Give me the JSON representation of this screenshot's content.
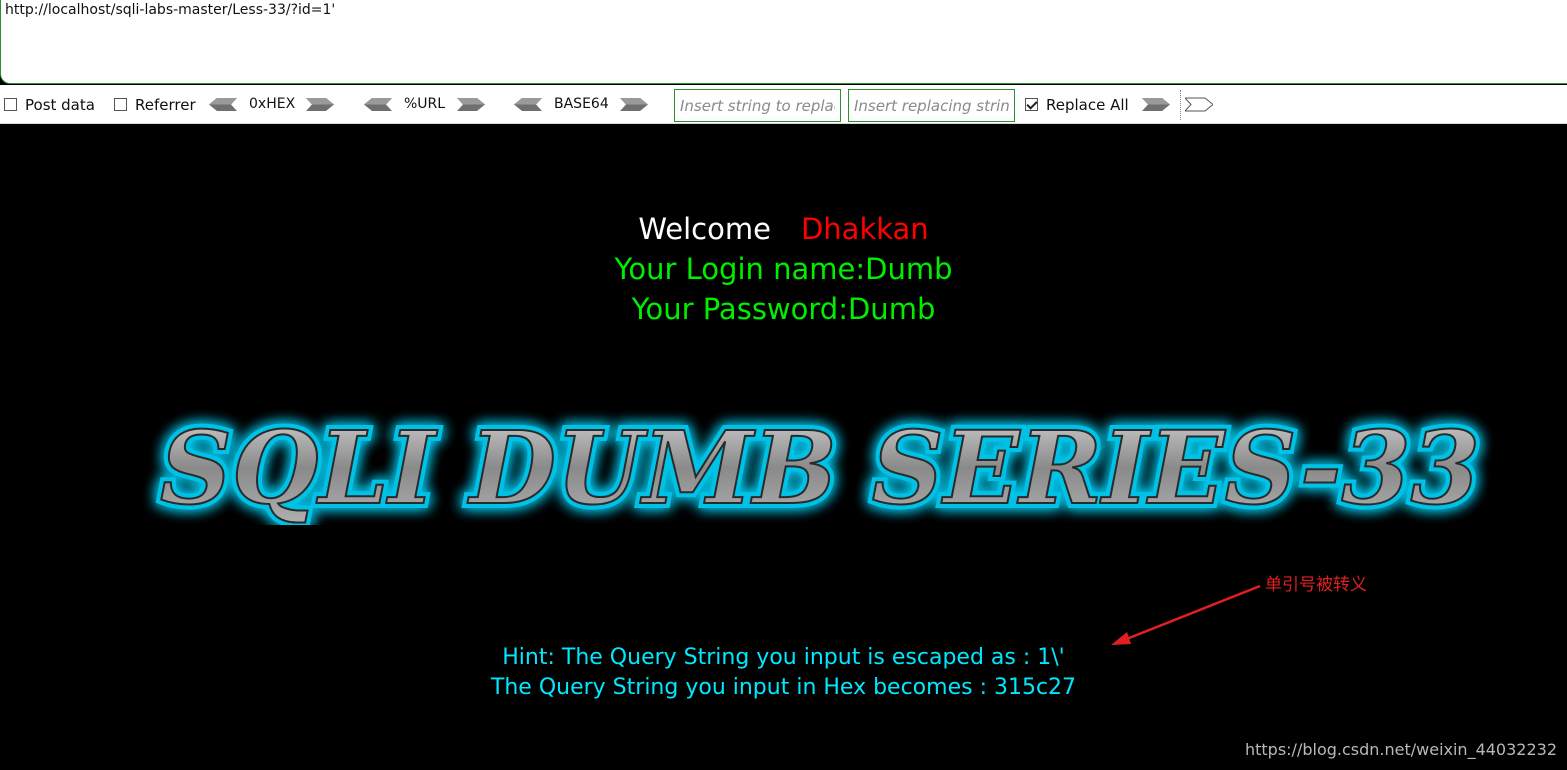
{
  "url_bar": {
    "value": "http://localhost/sqli-labs-master/Less-33/?id=1'"
  },
  "toolbar": {
    "post_data_label": "Post data",
    "referrer_label": "Referrer",
    "hex_label": "0xHEX",
    "url_label": "%URL",
    "base64_label": "BASE64",
    "replace_placeholder": "Insert string to replace",
    "replacing_placeholder": "Insert replacing string",
    "replace_all_label": "Replace All",
    "post_data_checked": false,
    "referrer_checked": false,
    "replace_all_checked": true
  },
  "page": {
    "welcome": "Welcome",
    "user": "Dhakkan",
    "login_name": "Your Login name:Dumb",
    "password": "Your Password:Dumb",
    "banner": "SQLI DUMB SERIES-33",
    "hint_escaped": "Hint: The Query String you input is escaped as : 1\\'",
    "hint_hex": "The Query String you input in Hex becomes : 315c27"
  },
  "annotation": {
    "text": "单引号被转义"
  },
  "watermark": "https://blog.csdn.net/weixin_44032232",
  "colors": {
    "background": "#000000",
    "welcome": "#ffffff",
    "user": "#ff0000",
    "credentials": "#00ee00",
    "hint": "#00e8ff",
    "banner_glow": "#00d8ff",
    "annotation": "#e02020"
  }
}
